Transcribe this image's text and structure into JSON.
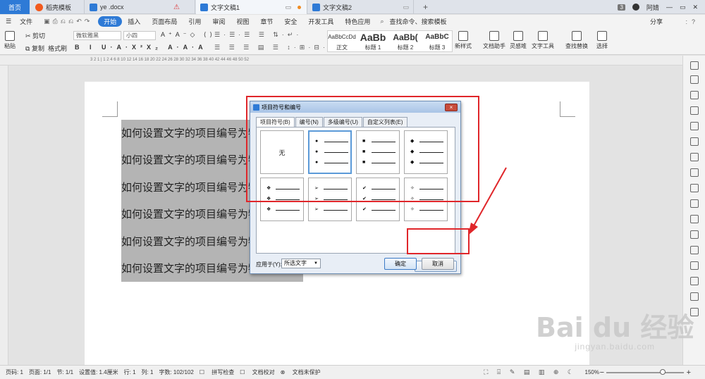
{
  "tabs": {
    "home": "首页",
    "t1": "稻壳模板",
    "t2": "ye .docx",
    "t3": "文字文稿1",
    "t4": "文字文稿2",
    "new_tab": "+"
  },
  "title_right": {
    "badge": "3",
    "user": "阿婧"
  },
  "menu": {
    "file": "文件",
    "items": [
      "开始",
      "插入",
      "页面布局",
      "引用",
      "审阅",
      "视图",
      "章节",
      "安全",
      "开发工具",
      "特色应用"
    ],
    "search": "查找命令、搜索模板",
    "share": "分享",
    "more": ":",
    "help": "?"
  },
  "ribbon": {
    "paste": "粘贴",
    "cut": "剪切",
    "copy": "复制",
    "format_painter": "格式刷",
    "font_name": "微软雅黑",
    "font_size": "小四",
    "styles": [
      {
        "preview": "AaBbCcDd",
        "name": "正文"
      },
      {
        "preview": "AaBb",
        "name": "标题 1"
      },
      {
        "preview": "AaBb(",
        "name": "标题 2"
      },
      {
        "preview": "AaBbC",
        "name": "标题 3"
      }
    ],
    "new_style": "新样式",
    "doc_helper": "文档助手",
    "inspiration": "灵感堆",
    "text_tools": "文字工具",
    "find_replace": "查找替换",
    "select": "选择"
  },
  "ruler_numbers": "3 2 1 | 1 2 4 6 8 10 12 14 16 18 20 22 24 26 28 30 32 34 36 38 40 42 44 46 48 50 52",
  "document": {
    "lines": [
      "如何设置文字的项目编号为物",
      "如何设置文字的项目编号为物",
      "如何设置文字的项目编号为物",
      "如何设置文字的项目编号为物",
      "如何设置文字的项目编号为物",
      "如何设置文字的项目编号为物"
    ]
  },
  "dialog": {
    "title": "项目符号和编号",
    "close": "×",
    "tabs": [
      "项目符号(B)",
      "编号(N)",
      "多级编号(U)",
      "自定义列表(E)"
    ],
    "none_label": "无",
    "bullet_glyphs": [
      "●",
      "■",
      "◆",
      "❖",
      "➢",
      "✔",
      "✧"
    ],
    "custom_button": "自定义(T)...",
    "apply_label": "应用于(Y):",
    "apply_value": "所选文字",
    "ok": "确定",
    "cancel": "取消"
  },
  "watermark": {
    "main": "Bai du 经验",
    "url": "jingyan.baidu.com"
  },
  "status": {
    "page_num": "页码: 1",
    "pages": "页面: 1/1",
    "section": "节: 1/1",
    "position": "设置值: 1.4厘米",
    "row": "行: 1",
    "col": "列: 1",
    "words": "字数: 102/102",
    "spell": "拼写检查",
    "proof": "文档校对",
    "protect": "文档未保护",
    "zoom": "150%"
  },
  "colors": {
    "accent": "#2e7ad6",
    "annotation_red": "#e0262a",
    "selection": "#b4b4b4"
  }
}
